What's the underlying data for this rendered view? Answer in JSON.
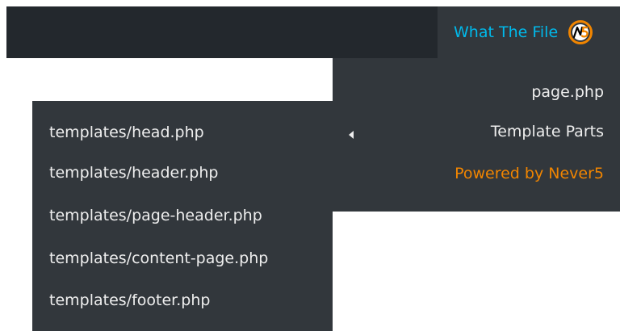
{
  "admin_bar": {
    "menu_title": "What The File",
    "logo_icon": "never5-logo-icon",
    "accent_color": "#00b9eb",
    "logo_color": "#f18500"
  },
  "main_dropdown": {
    "items": [
      {
        "label": "page.php"
      },
      {
        "label": "Template Parts",
        "submenu_indicator": "left-arrow-icon"
      },
      {
        "label": "Powered by Never5"
      }
    ]
  },
  "template_parts_submenu": {
    "items": [
      {
        "label": "templates/head.php"
      },
      {
        "label": "templates/header.php"
      },
      {
        "label": "templates/page-header.php"
      },
      {
        "label": "templates/content-page.php"
      },
      {
        "label": "templates/footer.php"
      }
    ]
  },
  "colors": {
    "bar_background": "#23282d",
    "menu_background": "#32373c",
    "text": "#eeeeee",
    "powered_by": "#f18500"
  }
}
